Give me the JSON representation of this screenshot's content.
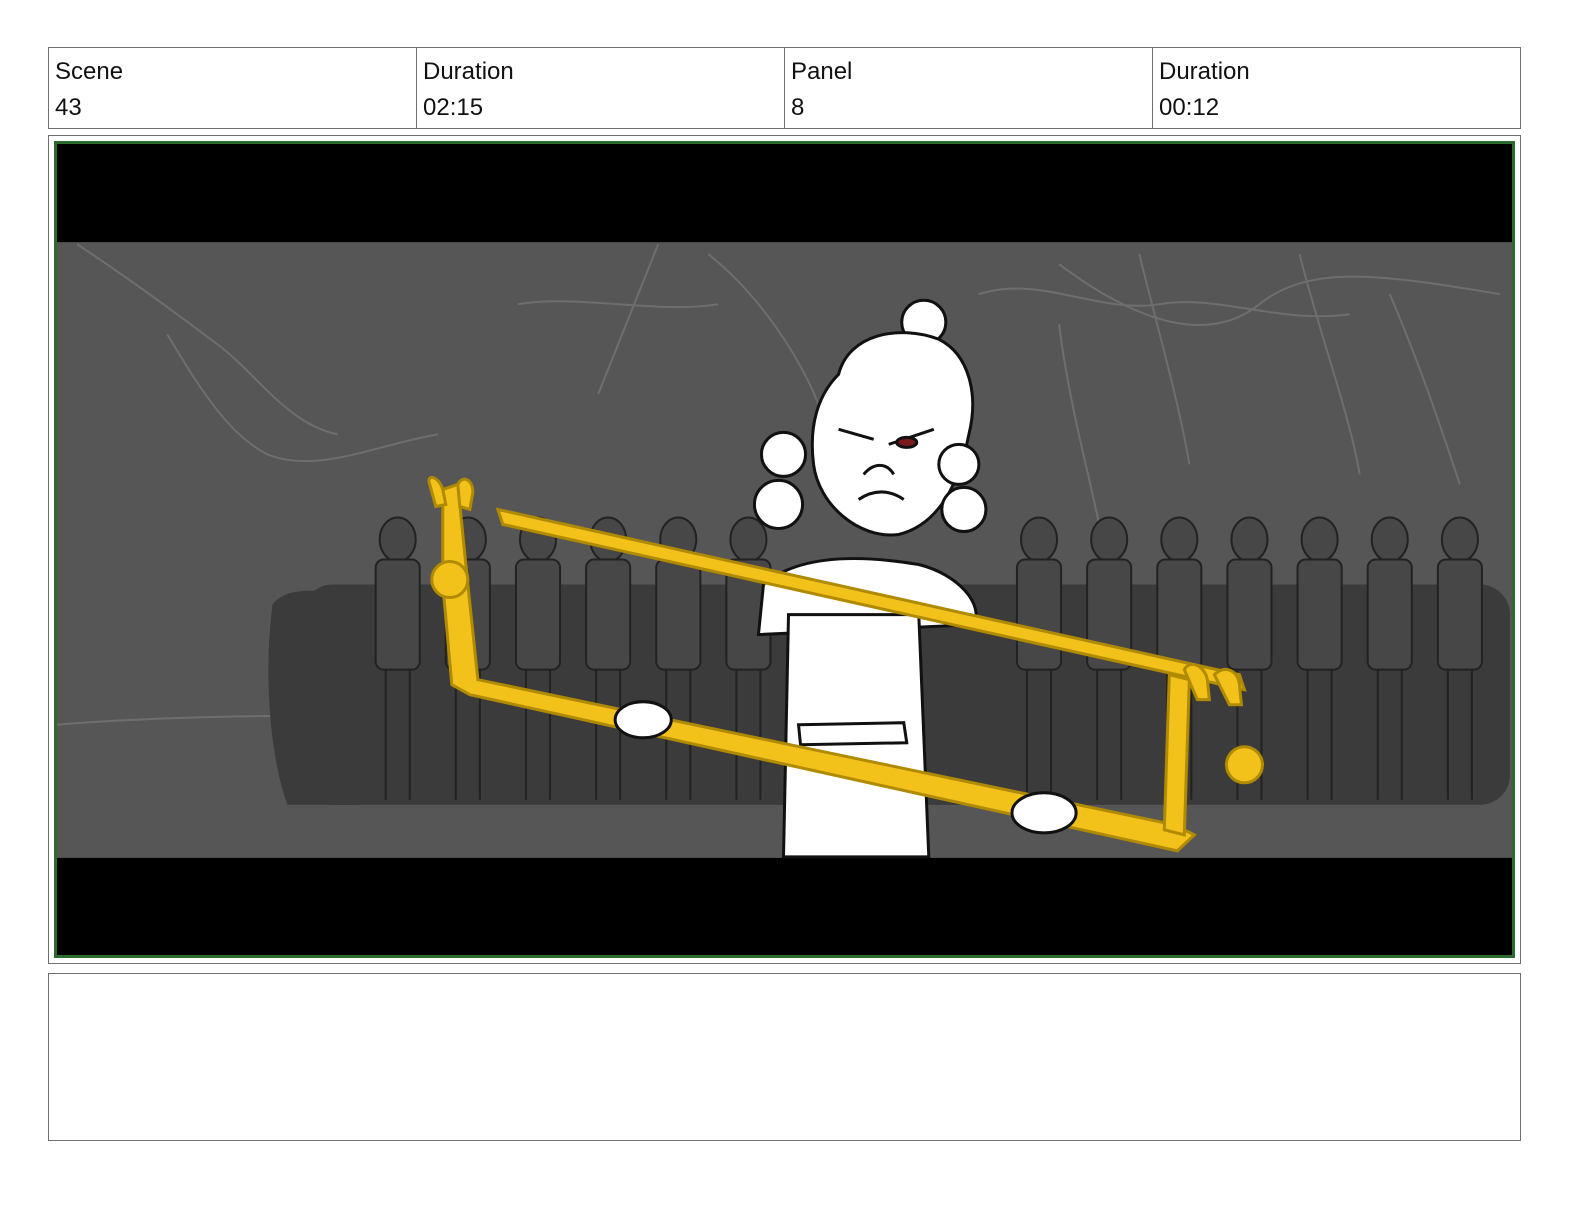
{
  "header": {
    "scene_label": "Scene",
    "scene_value": "43",
    "scene_duration_label": "Duration",
    "scene_duration_value": "02:15",
    "panel_label": "Panel",
    "panel_value": "8",
    "panel_duration_label": "Duration",
    "panel_duration_value": "00:12"
  },
  "panel_image": {
    "description_icon": "storyboard-sketch-character-with-golden-staff",
    "accent_color": "#f2c21b",
    "background_color": "#555555",
    "crowd_color": "#3a3a3a",
    "frame_border_color": "#2e6b2e"
  },
  "notes": {
    "text": ""
  }
}
